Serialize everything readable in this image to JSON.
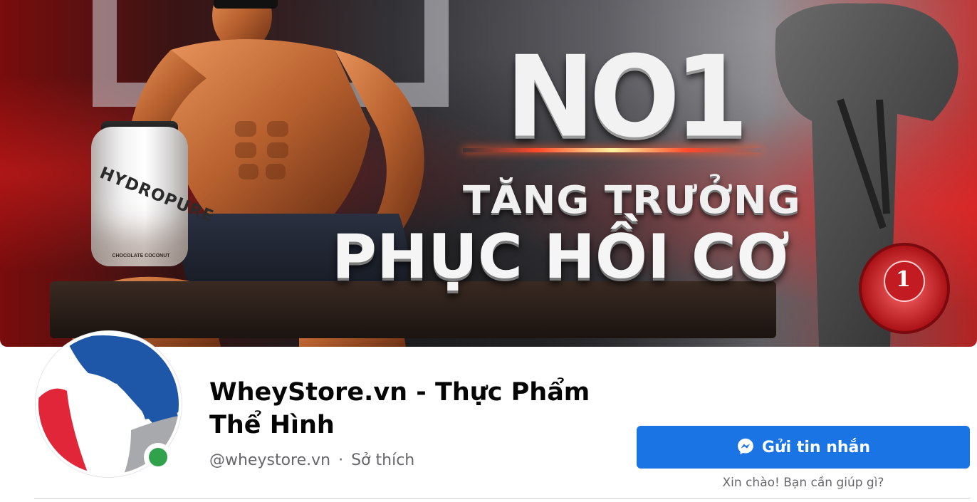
{
  "cover": {
    "headline_top": "NO1",
    "headline_middle": "TĂNG TRƯỞNG",
    "headline_bottom": "PHỤC HỒI CƠ",
    "product_name": "HYDROPURE",
    "product_flavor": "CHOCOLATE COCONUT",
    "medal_number": "1",
    "accent_color": "#d71f26"
  },
  "profile": {
    "name": "WheyStore.vn - Thực Phẩm Thể Hình",
    "username": "@wheystore.vn",
    "separator": "·",
    "category": "Sở thích",
    "online_status_color": "#31a24c",
    "avatar_icon": "wheystore-logo-icon"
  },
  "actions": {
    "message_button_label": "Gửi tin nhắn",
    "message_button_icon": "messenger-icon",
    "message_hint": "Xin chào! Bạn cần giúp gì?",
    "button_color": "#1b74e4"
  }
}
